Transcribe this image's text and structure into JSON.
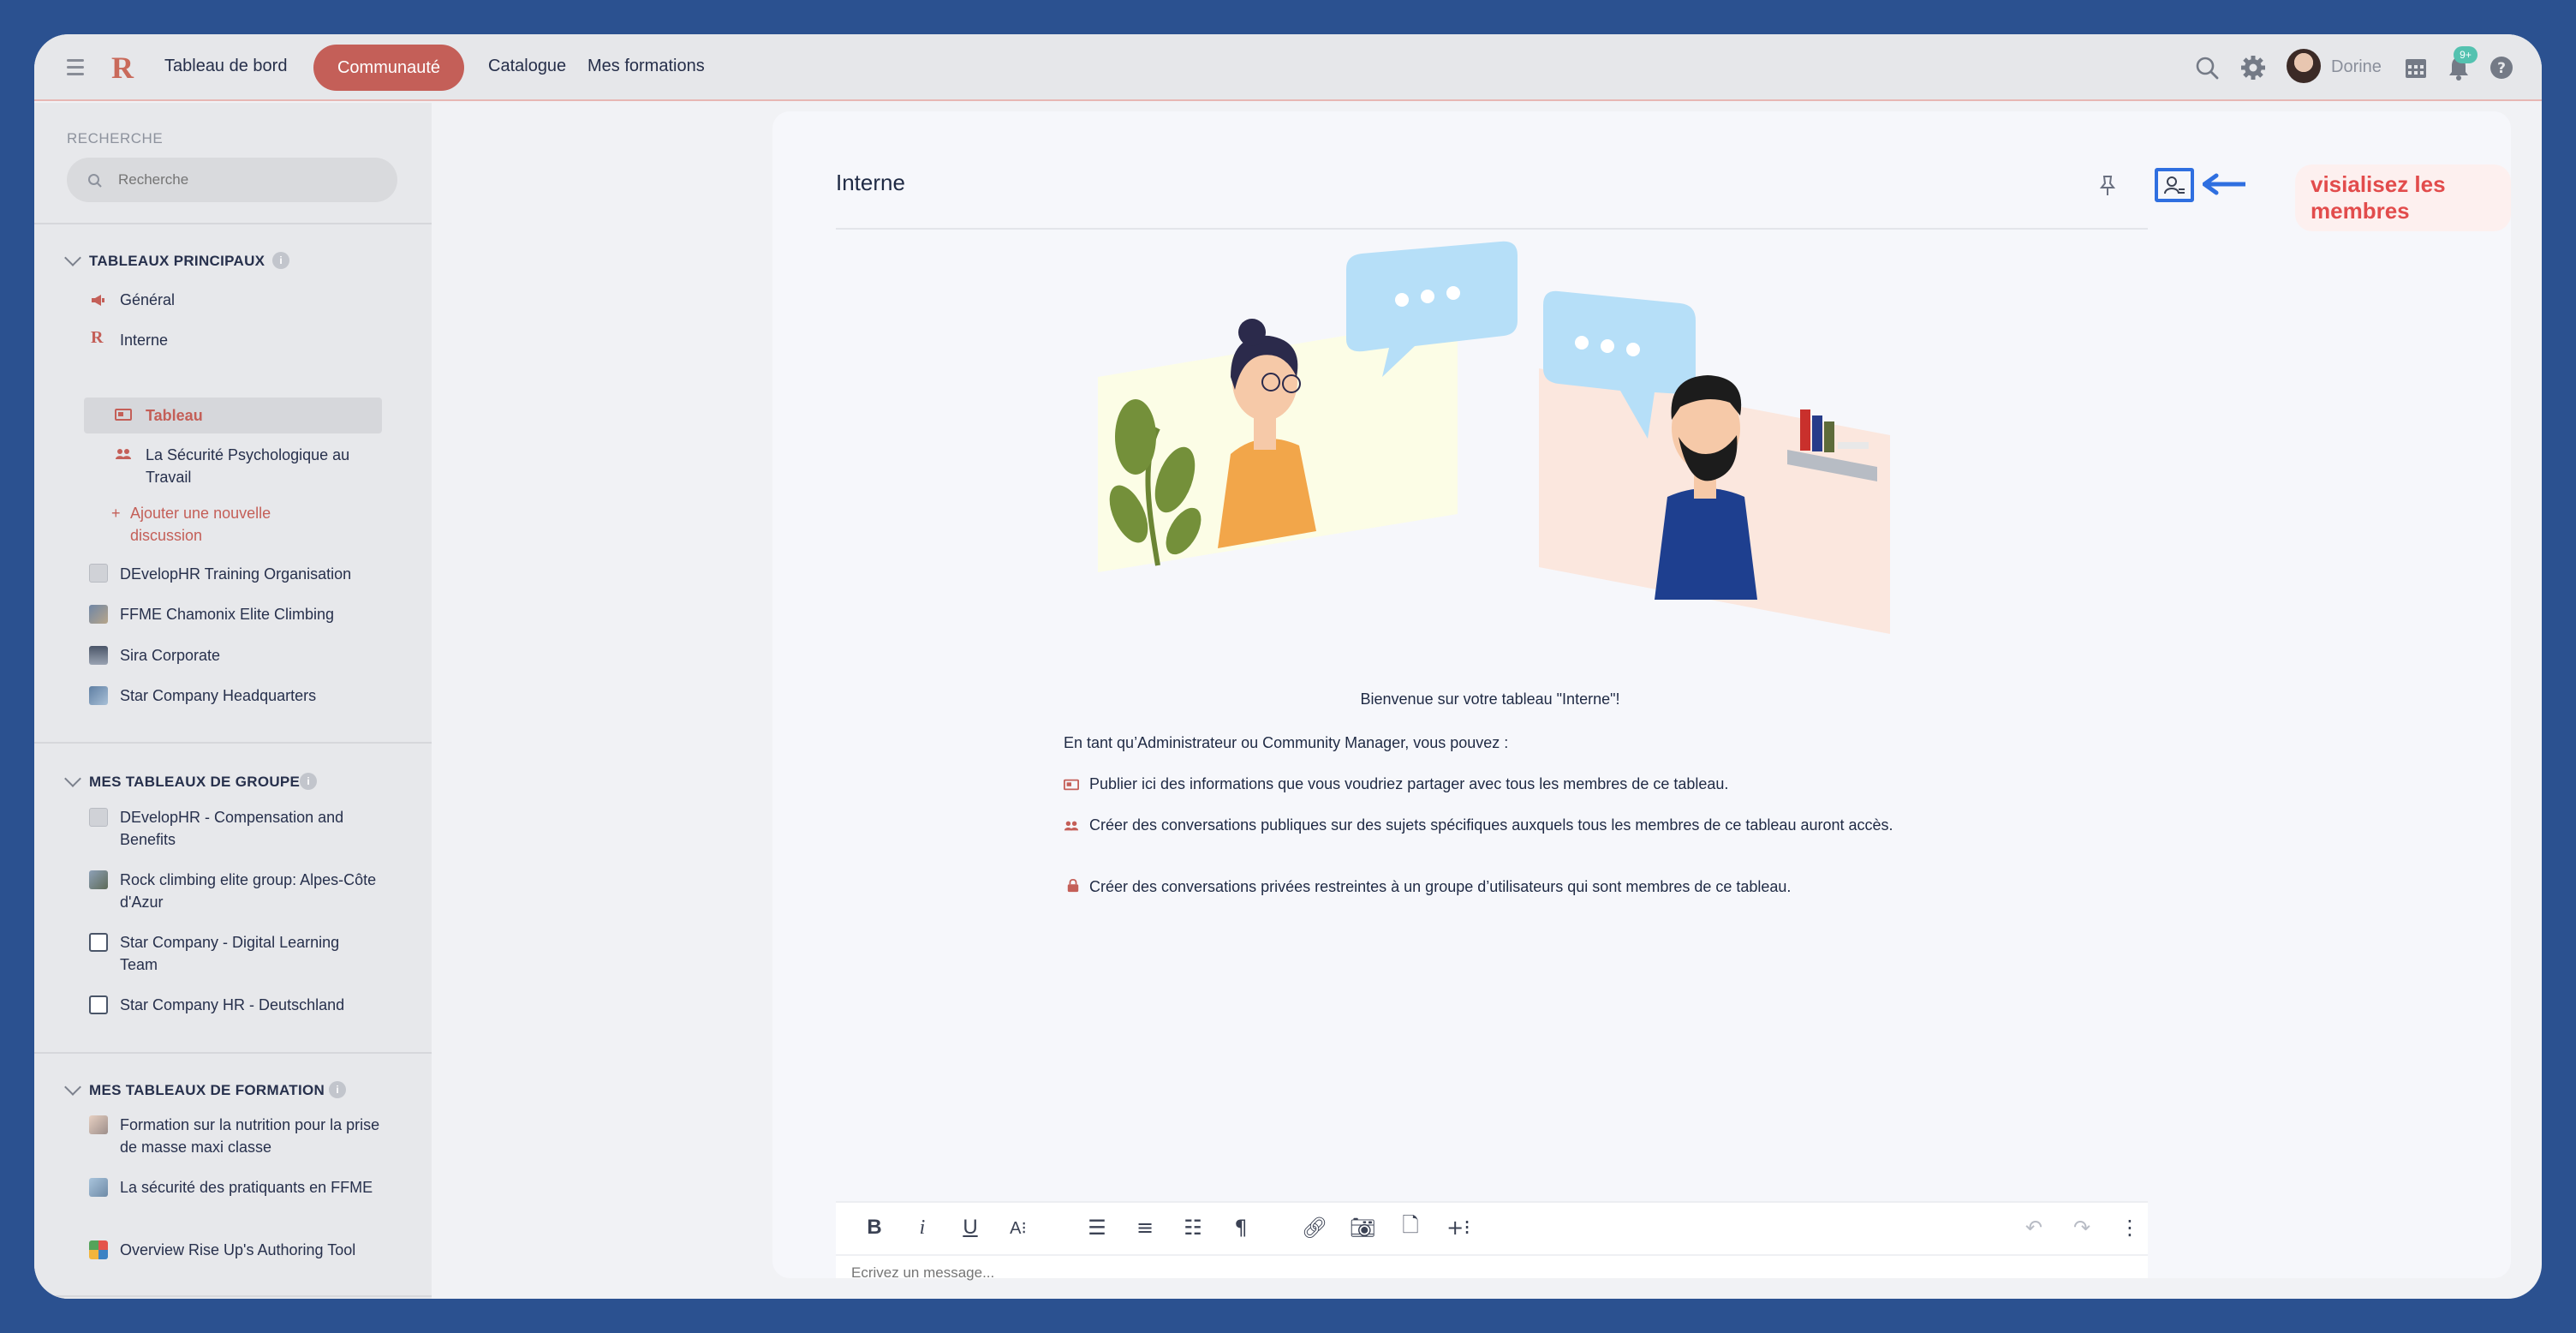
{
  "topbar": {
    "logo": "R",
    "nav": [
      "Tableau de bord",
      "Communauté",
      "Catalogue",
      "Mes formations"
    ],
    "user_name": "Dorine",
    "notif_badge": "9+"
  },
  "sidebar": {
    "search_label": "RECHERCHE",
    "search_placeholder": "Recherche",
    "main_boards_title": "TABLEAUX PRINCIPAUX",
    "main_boards": [
      {
        "label": "Général"
      },
      {
        "label": "Interne"
      },
      {
        "label": "Tableau"
      },
      {
        "label": "La Sécurité Psychologique au Travail"
      },
      {
        "label": "Ajouter une nouvelle discussion"
      },
      {
        "label": "DEvelopHR Training Organisation"
      },
      {
        "label": "FFME Chamonix Elite Climbing"
      },
      {
        "label": "Sira Corporate"
      },
      {
        "label": "Star Company Headquarters"
      }
    ],
    "group_boards_title": "MES TABLEAUX DE GROUPE",
    "group_boards": [
      {
        "label": "DEvelopHR - Compensation and Benefits"
      },
      {
        "label": "Rock climbing elite group: Alpes-Côte d'Azur"
      },
      {
        "label": "Star Company - Digital Learning Team"
      },
      {
        "label": "Star Company HR - Deutschland"
      }
    ],
    "training_boards_title": "MES TABLEAUX DE FORMATION",
    "training_boards": [
      {
        "label": "Formation sur la nutrition pour la prise de masse maxi classe"
      },
      {
        "label": "La sécurité des pratiquants en FFME"
      },
      {
        "label": "Overview Rise Up's Authoring Tool"
      }
    ],
    "accent_color": "#c45f58"
  },
  "main": {
    "title": "Interne",
    "callout": "visialisez les membres",
    "welcome": "Bienvenue sur votre tableau \"Interne\"!",
    "intro": "En tant qu’Administrateur ou Community Manager, vous pouvez :",
    "bullets": [
      "Publier ici des informations que vous voudriez partager avec tous les membres de ce tableau.",
      "Créer des conversations publiques sur des sujets spécifiques auxquels tous les membres de ce tableau auront accès.",
      "Créer des conversations privées restreintes à un groupe d’utilisateurs qui sont membres de ce tableau."
    ],
    "editor_placeholder": "Ecrivez un message..."
  }
}
